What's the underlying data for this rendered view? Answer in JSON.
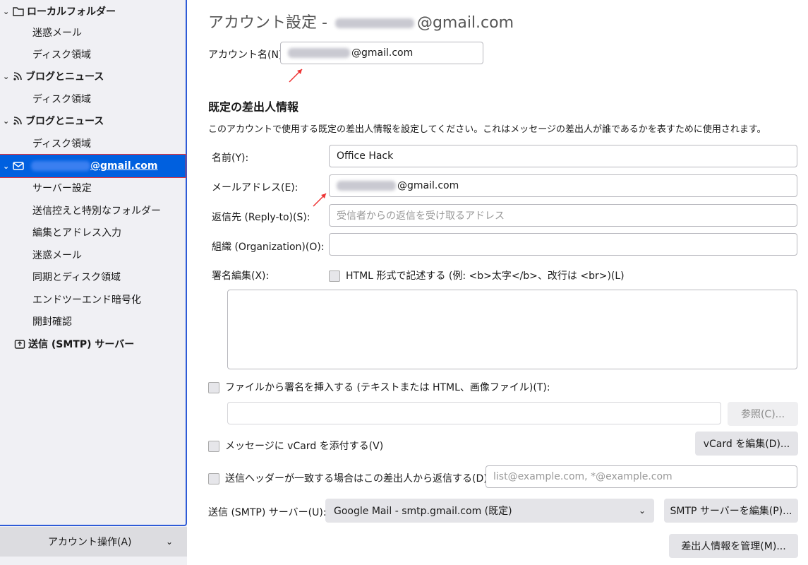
{
  "sidebar": {
    "items": [
      {
        "label": "ローカルフォルダー"
      },
      {
        "label": "迷惑メール"
      },
      {
        "label": "ディスク領域"
      },
      {
        "label": "ブログとニュース"
      },
      {
        "label": "ディスク領域"
      },
      {
        "label": "ブログとニュース"
      },
      {
        "label": "ディスク領域"
      },
      {
        "label": "@gmail.com"
      },
      {
        "label": "サーバー設定"
      },
      {
        "label": "送信控えと特別なフォルダー"
      },
      {
        "label": "編集とアドレス入力"
      },
      {
        "label": "迷惑メール"
      },
      {
        "label": "同期とディスク領域"
      },
      {
        "label": "エンドツーエンド暗号化"
      },
      {
        "label": "開封確認"
      },
      {
        "label": "送信 (SMTP) サーバー"
      }
    ],
    "account_actions": "アカウント操作(A)"
  },
  "main": {
    "title_prefix": "アカウント設定 -",
    "title_suffix": "@gmail.com",
    "account_name_label": "アカウント名(N):",
    "account_name_value": "@gmail.com",
    "identity_heading": "既定の差出人情報",
    "identity_desc": "このアカウントで使用する既定の差出人情報を設定してください。これはメッセージの差出人が誰であるかを表すために使用されます。",
    "name_label": "名前(Y):",
    "name_value": "Office Hack",
    "email_label": "メールアドレス(E):",
    "email_value": "@gmail.com",
    "replyto_label": "返信先 (Reply-to)(S):",
    "replyto_placeholder": "受信者からの返信を受け取るアドレス",
    "org_label": "組織 (Organization)(O):",
    "sig_label": "署名編集(X):",
    "html_sig_label": "HTML 形式で記述する (例: <b>太字</b>、改行は <br>)(L)",
    "attach_sig_label": "ファイルから署名を挿入する (テキストまたは HTML、画像ファイル)(T):",
    "browse_button": "参照(C)...",
    "vcard_label": "メッセージに vCard を添付する(V)",
    "vcard_edit_button": "vCard を編集(D)...",
    "reply_header_label": "送信ヘッダーが一致する場合はこの差出人から返信する(D):",
    "reply_header_placeholder": "list@example.com, *@example.com",
    "smtp_label": "送信 (SMTP) サーバー(U):",
    "smtp_value": "Google Mail - smtp.gmail.com (既定)",
    "smtp_edit_button": "SMTP サーバーを編集(P)...",
    "manage_identities_button": "差出人情報を管理(M)..."
  }
}
